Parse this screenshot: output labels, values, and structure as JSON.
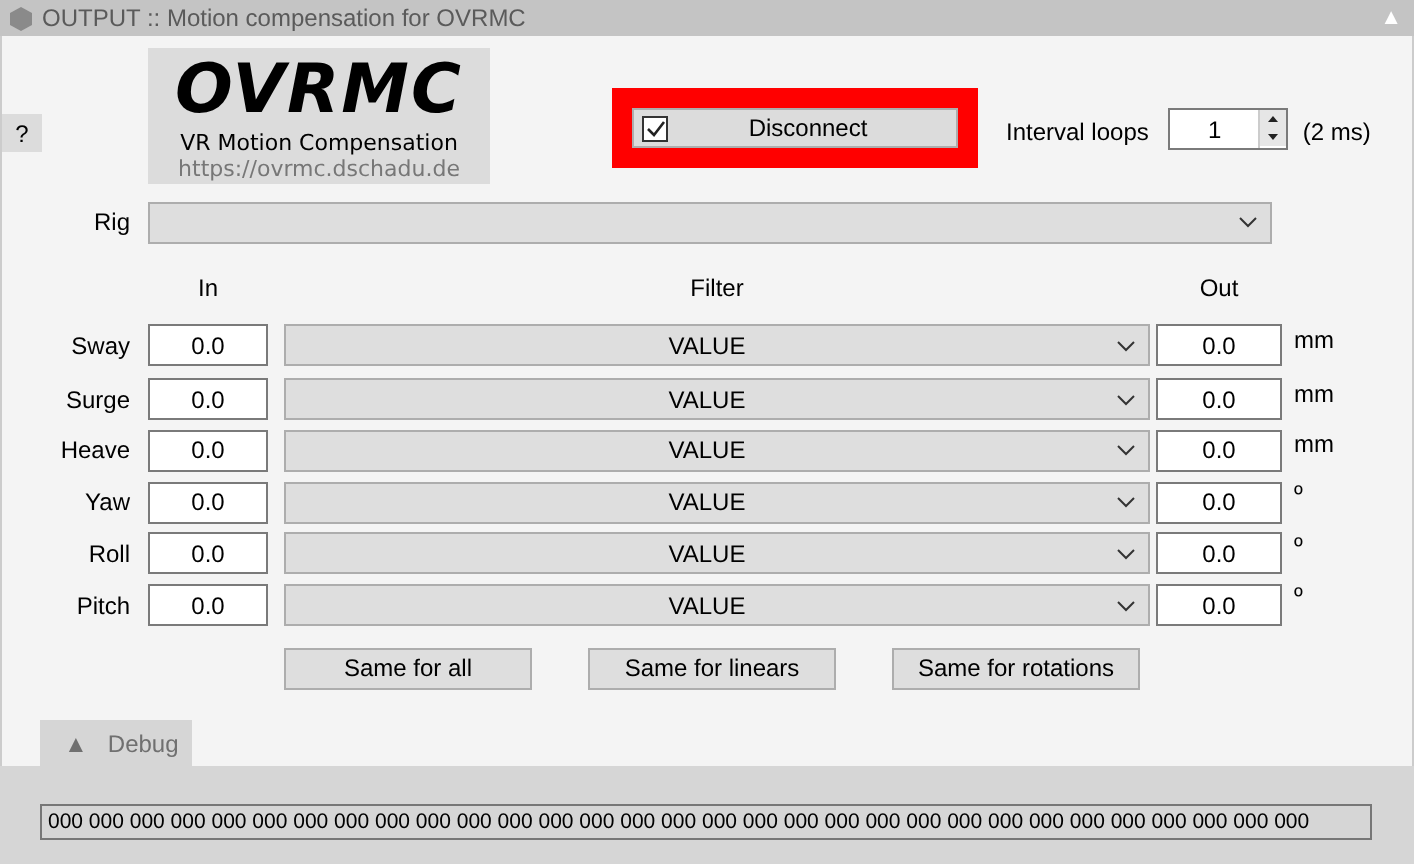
{
  "window": {
    "title": "OUTPUT :: Motion compensation for OVRMC",
    "collapse_glyph": "▲"
  },
  "help_button": "?",
  "logo": {
    "title": "OVRMC",
    "subtitle": "VR Motion Compensation",
    "url": "https://ovrmc.dschadu.de"
  },
  "connect": {
    "label": "Disconnect",
    "checked": true
  },
  "interval": {
    "label": "Interval loops",
    "value": "1",
    "note": "(2 ms)"
  },
  "rig": {
    "label": "Rig"
  },
  "columns": {
    "in": "In",
    "filter": "Filter",
    "out": "Out"
  },
  "axes": [
    {
      "name": "Sway",
      "in": "0.0",
      "filter": "VALUE",
      "out": "0.0",
      "unit": "mm"
    },
    {
      "name": "Surge",
      "in": "0.0",
      "filter": "VALUE",
      "out": "0.0",
      "unit": "mm"
    },
    {
      "name": "Heave",
      "in": "0.0",
      "filter": "VALUE",
      "out": "0.0",
      "unit": "mm"
    },
    {
      "name": "Yaw",
      "in": "0.0",
      "filter": "VALUE",
      "out": "0.0",
      "unit": "º"
    },
    {
      "name": "Roll",
      "in": "0.0",
      "filter": "VALUE",
      "out": "0.0",
      "unit": "º"
    },
    {
      "name": "Pitch",
      "in": "0.0",
      "filter": "VALUE",
      "out": "0.0",
      "unit": "º"
    }
  ],
  "buttons": [
    "Same for all",
    "Same for linears",
    "Same for rotations"
  ],
  "debug": {
    "tab": {
      "glyph": "▲",
      "label": "Debug",
      "expanded": true
    },
    "output": "000 000 000 000 000 000 000 000 000 000 000 000 000 000 000 000 000 000 000 000 000 000 000 000 000 000 000 000 000 000 000"
  }
}
